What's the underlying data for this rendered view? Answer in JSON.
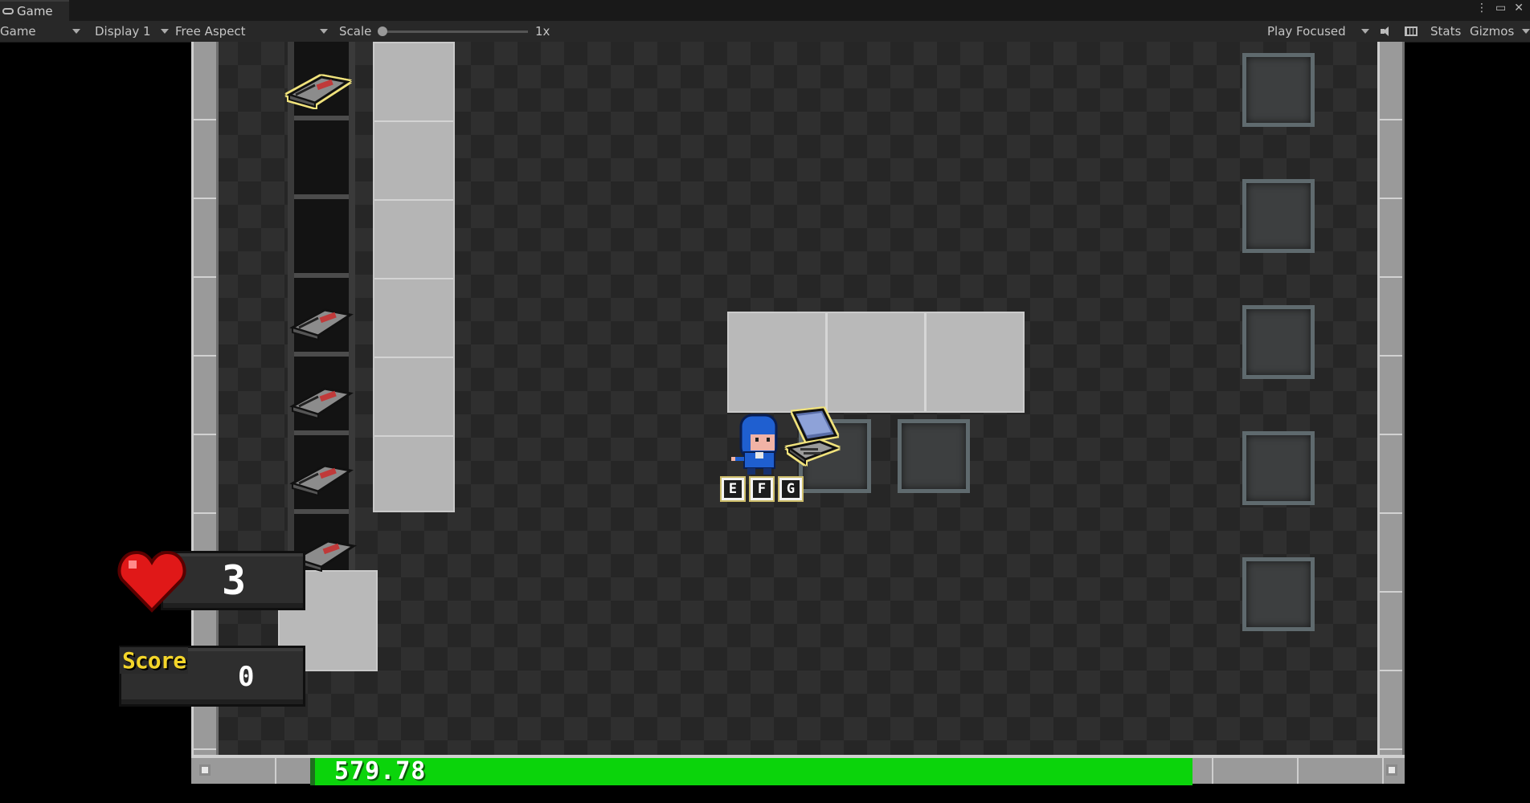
{
  "editor": {
    "tab_title": "Game",
    "view_mode": "Game",
    "display": "Display 1",
    "aspect": "Free Aspect",
    "scale_label": "Scale",
    "scale_value": "1x",
    "play_mode": "Play Focused",
    "stats_label": "Stats",
    "gizmos_label": "Gizmos"
  },
  "hud": {
    "lives": "3",
    "score_label": "Score",
    "score": "0",
    "timer": "579.78",
    "timer_fill": 1.0
  },
  "prompt_keys": [
    "E",
    "F",
    "G"
  ],
  "colors": {
    "timer_green": "#0bd40b",
    "score_yellow": "#f3d52a",
    "heart_red": "#e01818",
    "player_blue": "#1f5fd0",
    "highlight": "#f0e27c"
  }
}
